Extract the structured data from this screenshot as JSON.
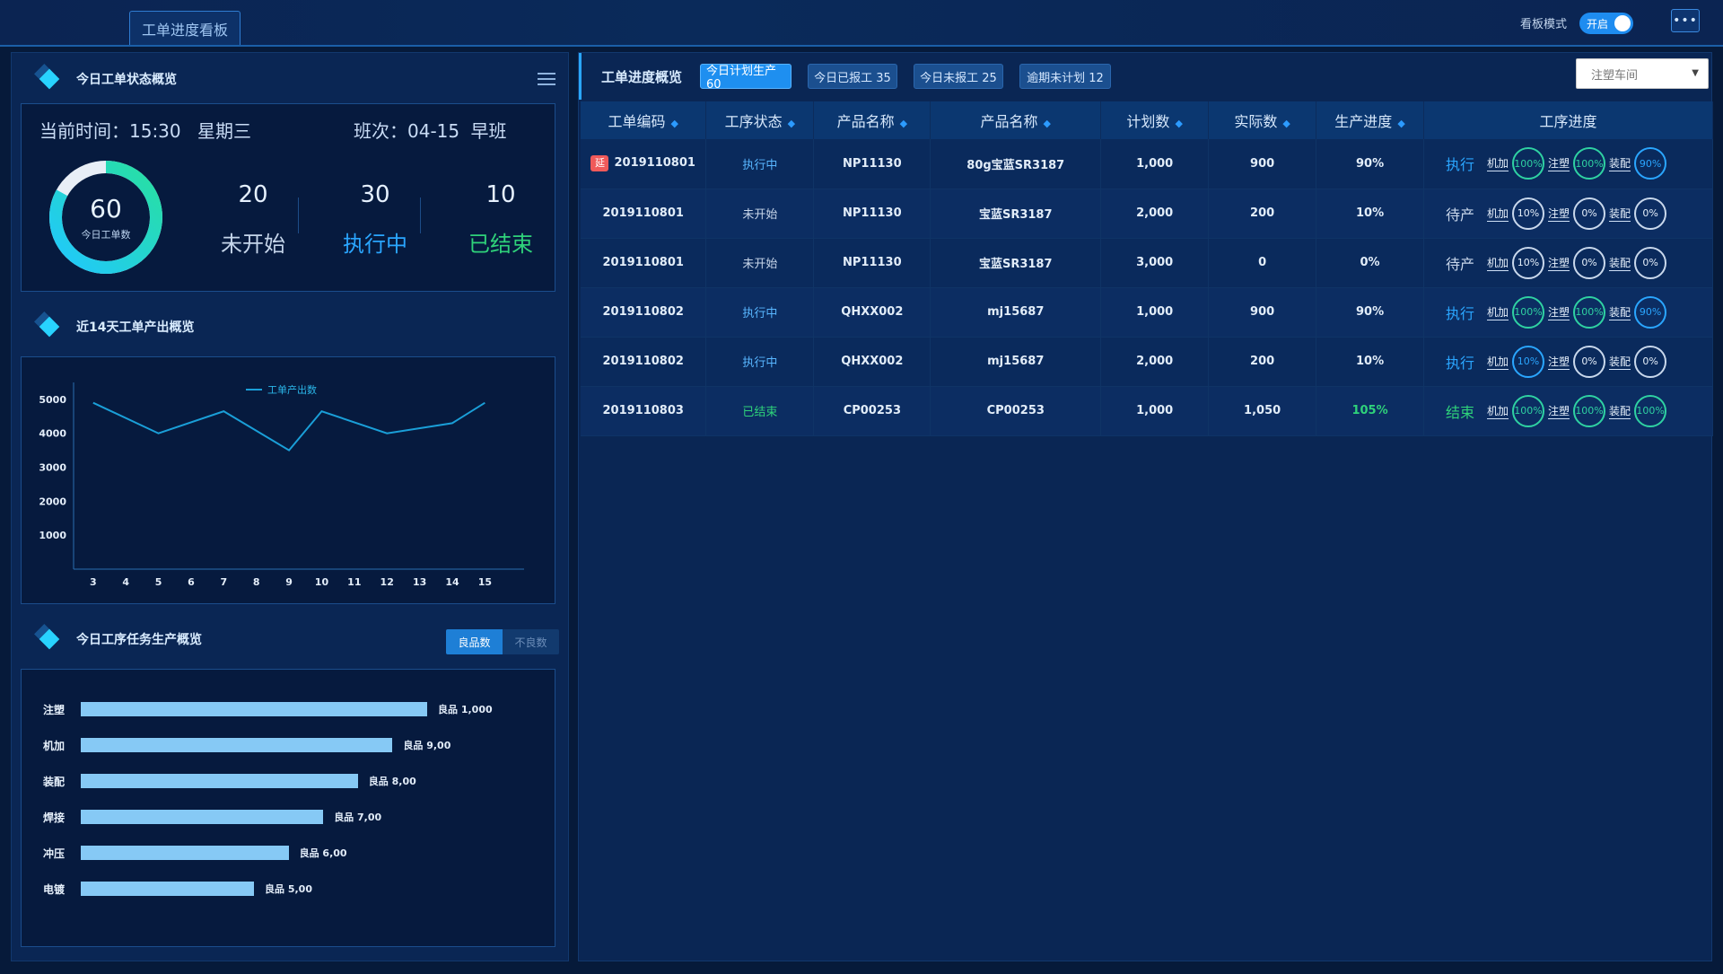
{
  "top": {
    "tab": "工单进度看板",
    "board_mode_label": "看板模式",
    "toggle_label": "开启",
    "more_label": "•••"
  },
  "status_overview": {
    "title": "今日工单状态概览",
    "current_time": "当前时间：15:30",
    "weekday": "星期三",
    "shift": "班次：04-15  早班",
    "total": "60",
    "total_label": "今日工单数",
    "total_fraction_done": 0.83,
    "stats": [
      {
        "num": "20",
        "label": "未开始",
        "color": "#c5d5ea"
      },
      {
        "num": "30",
        "label": "执行中",
        "color": "#2aa6ff"
      },
      {
        "num": "10",
        "label": "已结束",
        "color": "#2fd27a"
      }
    ]
  },
  "output_chart": {
    "title": "近14天工单产出概览",
    "chart_data": {
      "type": "line",
      "legend": "工单产出数",
      "x": [
        "3",
        "4",
        "5",
        "6",
        "7",
        "8",
        "9",
        "10",
        "11",
        "12",
        "13",
        "14",
        "15"
      ],
      "series": [
        {
          "name": "工单产出数",
          "x": [
            3,
            5,
            7,
            9,
            10,
            12,
            14,
            15
          ],
          "values": [
            4900,
            4000,
            4650,
            3500,
            4650,
            4000,
            4300,
            4900
          ]
        }
      ],
      "yticks": [
        "5000",
        "4000",
        "3000",
        "2000",
        "1000"
      ],
      "ylim": [
        0,
        5500
      ],
      "color": "#1a9fd8"
    }
  },
  "task_chart": {
    "title": "今日工序任务生产概览",
    "seg_on": "良品数",
    "seg_off": "不良数",
    "chart_data": {
      "type": "bar",
      "categories": [
        "注塑",
        "机加",
        "装配",
        "焊接",
        "冲压",
        "电镀"
      ],
      "values": [
        1000,
        900,
        800,
        700,
        600,
        500
      ],
      "labels": [
        "良品 1,000",
        "良品 9,00",
        "良品 8,00",
        "良品 7,00",
        "良品 6,00",
        "良品 5,00"
      ],
      "color": "#86c9f5"
    }
  },
  "progress": {
    "title": "工单进度概览",
    "chips": [
      "今日计划生产 60",
      "今日已报工 35",
      "今日未报工 25",
      "逾期未计划 12"
    ],
    "select": "注塑车间",
    "headers": [
      "工单编码",
      "工序状态",
      "产品名称",
      "产品名称",
      "计划数",
      "实际数",
      "生产进度",
      "工序进度"
    ],
    "rows": [
      {
        "late": "延",
        "code": "2019110801",
        "status": "执行中",
        "product": "NP11130",
        "name": "80g宝蓝SR3187",
        "plan": "1,000",
        "actual": "900",
        "progress": "90%",
        "state": "执行",
        "ops": [
          {
            "op": "机加",
            "val": "100%",
            "c": "green"
          },
          {
            "op": "注塑",
            "val": "100%",
            "c": "green"
          },
          {
            "op": "装配",
            "val": "90%",
            "c": "blue"
          }
        ]
      },
      {
        "late": "",
        "code": "2019110801",
        "status": "未开始",
        "product": "NP11130",
        "name": "宝蓝SR3187",
        "plan": "2,000",
        "actual": "200",
        "progress": "10%",
        "state": "待产",
        "ops": [
          {
            "op": "机加",
            "val": "10%",
            "c": "white"
          },
          {
            "op": "注塑",
            "val": "0%",
            "c": "white"
          },
          {
            "op": "装配",
            "val": "0%",
            "c": "white"
          }
        ]
      },
      {
        "late": "",
        "code": "2019110801",
        "status": "未开始",
        "product": "NP11130",
        "name": "宝蓝SR3187",
        "plan": "3,000",
        "actual": "0",
        "progress": "0%",
        "state": "待产",
        "ops": [
          {
            "op": "机加",
            "val": "10%",
            "c": "white"
          },
          {
            "op": "注塑",
            "val": "0%",
            "c": "white"
          },
          {
            "op": "装配",
            "val": "0%",
            "c": "white"
          }
        ]
      },
      {
        "late": "",
        "code": "2019110802",
        "status": "执行中",
        "product": "QHXX002",
        "name": "mj15687",
        "plan": "1,000",
        "actual": "900",
        "progress": "90%",
        "state": "执行",
        "ops": [
          {
            "op": "机加",
            "val": "100%",
            "c": "green"
          },
          {
            "op": "注塑",
            "val": "100%",
            "c": "green"
          },
          {
            "op": "装配",
            "val": "90%",
            "c": "blue"
          }
        ]
      },
      {
        "late": "",
        "code": "2019110802",
        "status": "执行中",
        "product": "QHXX002",
        "name": "mj15687",
        "plan": "2,000",
        "actual": "200",
        "progress": "10%",
        "state": "执行",
        "ops": [
          {
            "op": "机加",
            "val": "10%",
            "c": "blue"
          },
          {
            "op": "注塑",
            "val": "0%",
            "c": "white"
          },
          {
            "op": "装配",
            "val": "0%",
            "c": "white"
          }
        ]
      },
      {
        "late": "",
        "code": "2019110803",
        "status": "已结束",
        "product": "CP00253",
        "name": "CP00253",
        "plan": "1,000",
        "actual": "1,050",
        "progress": "105%",
        "state": "结束",
        "ops": [
          {
            "op": "机加",
            "val": "100%",
            "c": "green"
          },
          {
            "op": "注塑",
            "val": "100%",
            "c": "green"
          },
          {
            "op": "装配",
            "val": "100%",
            "c": "green"
          }
        ]
      }
    ]
  }
}
